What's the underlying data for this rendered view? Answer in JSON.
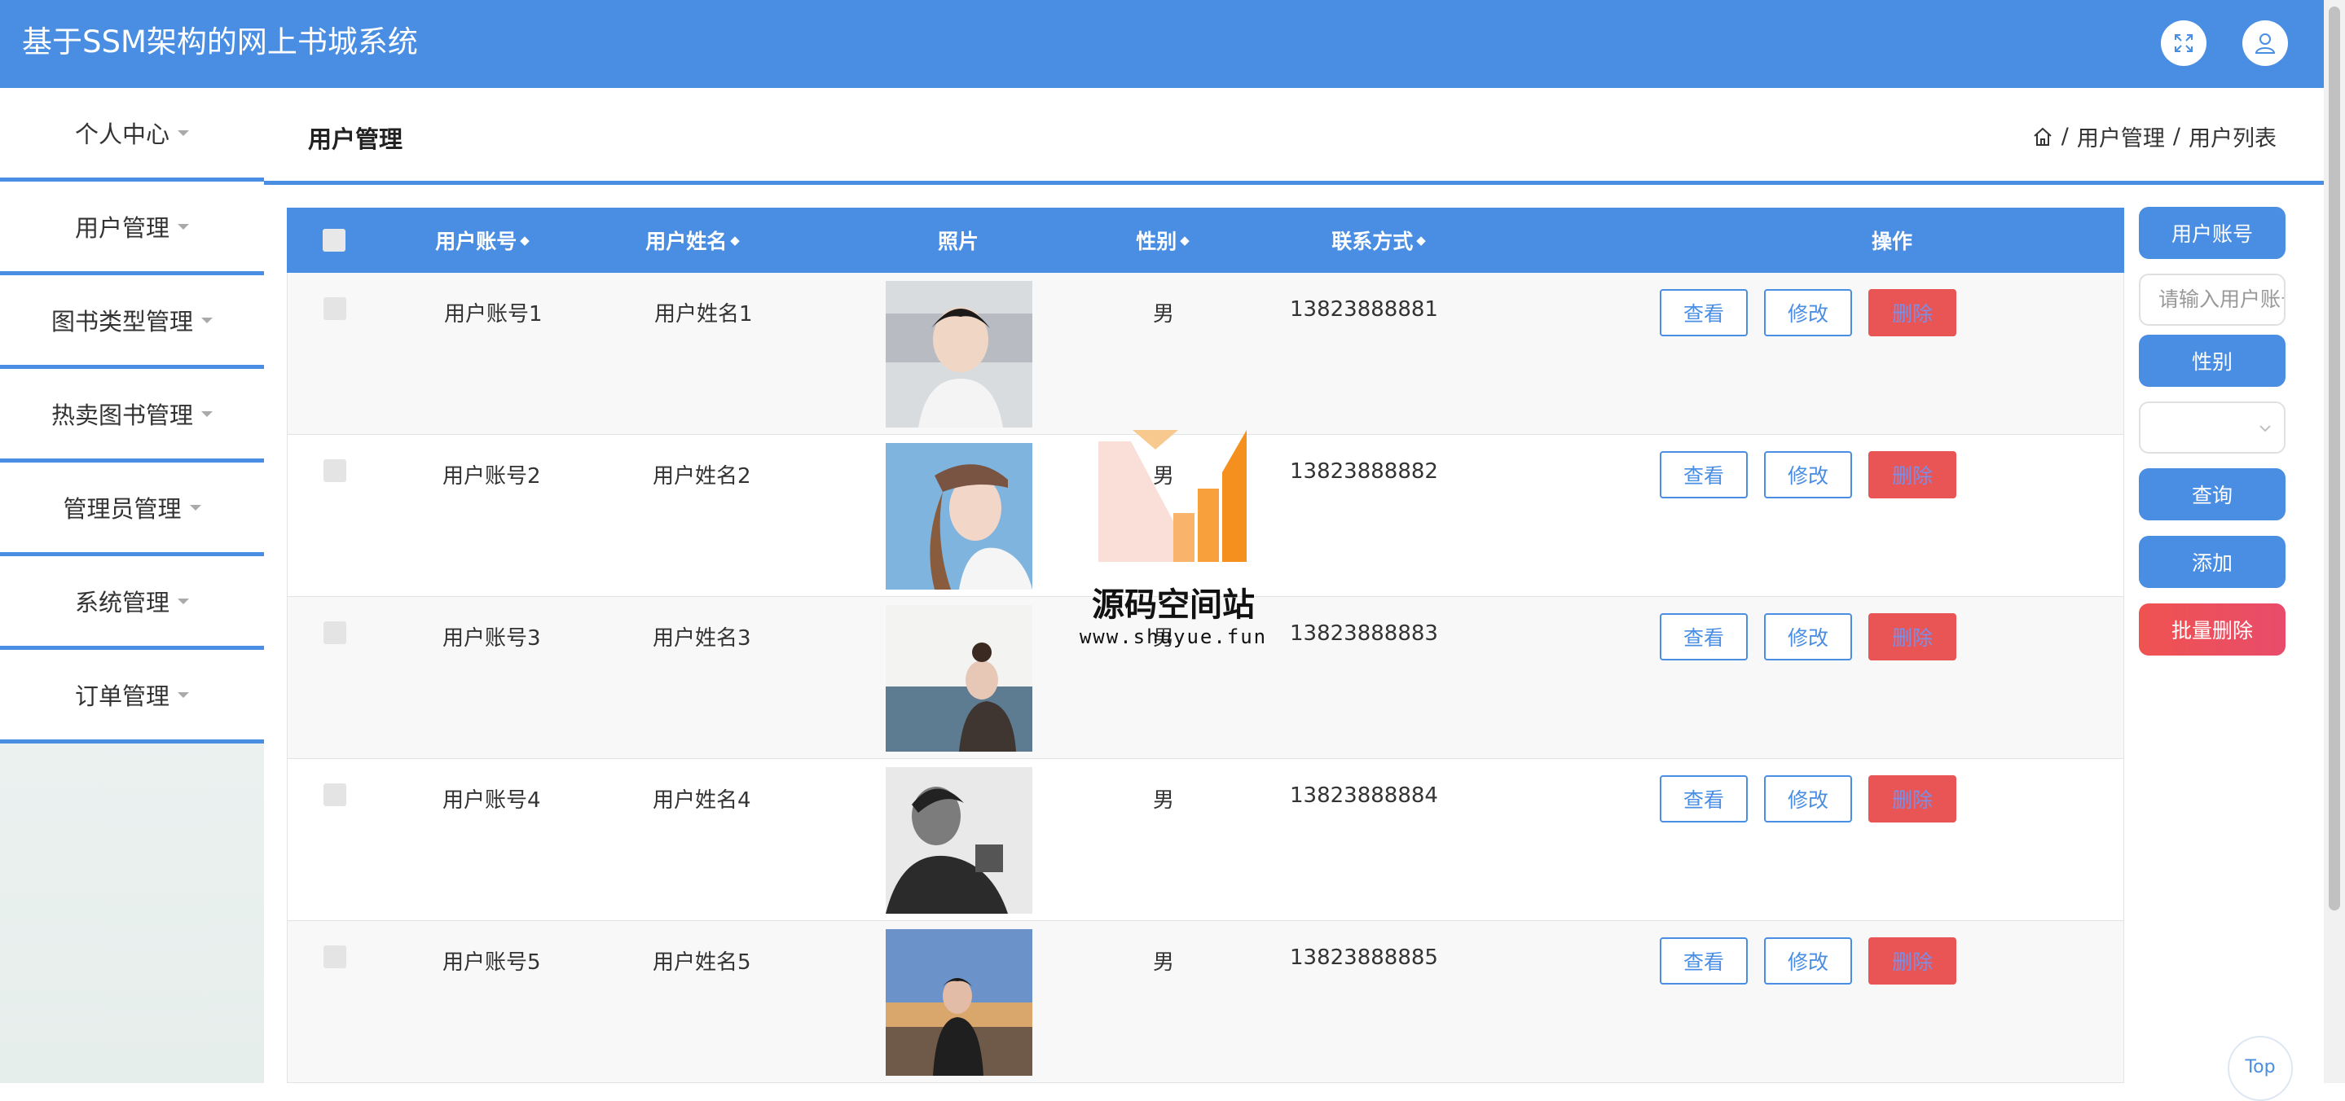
{
  "app": {
    "title": "基于SSM架构的网上书城系统"
  },
  "header": {
    "fullscreen_icon": "expand-icon",
    "user_icon": "user-icon"
  },
  "sidebar": {
    "items": [
      {
        "label": "个人中心"
      },
      {
        "label": "用户管理"
      },
      {
        "label": "图书类型管理"
      },
      {
        "label": "热卖图书管理"
      },
      {
        "label": "管理员管理"
      },
      {
        "label": "系统管理"
      },
      {
        "label": "订单管理"
      }
    ]
  },
  "page": {
    "title": "用户管理",
    "breadcrumb": [
      "用户管理",
      "用户列表"
    ],
    "breadcrumb_sep": "/"
  },
  "table": {
    "columns": [
      "用户账号",
      "用户姓名",
      "照片",
      "性别",
      "联系方式",
      "操作"
    ],
    "rows": [
      {
        "account": "用户账号1",
        "name": "用户姓名1",
        "gender": "男",
        "phone": "13823888881"
      },
      {
        "account": "用户账号2",
        "name": "用户姓名2",
        "gender": "男",
        "phone": "13823888882"
      },
      {
        "account": "用户账号3",
        "name": "用户姓名3",
        "gender": "男",
        "phone": "13823888883"
      },
      {
        "account": "用户账号4",
        "name": "用户姓名4",
        "gender": "男",
        "phone": "13823888884"
      },
      {
        "account": "用户账号5",
        "name": "用户姓名5",
        "gender": "男",
        "phone": "13823888885"
      }
    ],
    "actions": {
      "view": "查看",
      "edit": "修改",
      "delete": "删除"
    }
  },
  "filters": {
    "account_label": "用户账号",
    "account_placeholder": "请输入用户账号",
    "gender_label": "性别",
    "gender_value": "",
    "query": "查询",
    "add": "添加",
    "batch_delete": "批量删除"
  },
  "watermark": {
    "title": "源码空间站",
    "url": "www.shuyue.fun"
  },
  "back_to_top": "Top",
  "colors": {
    "primary": "#4a8ee3",
    "danger": "#e95454",
    "orange": "#f5901e"
  }
}
